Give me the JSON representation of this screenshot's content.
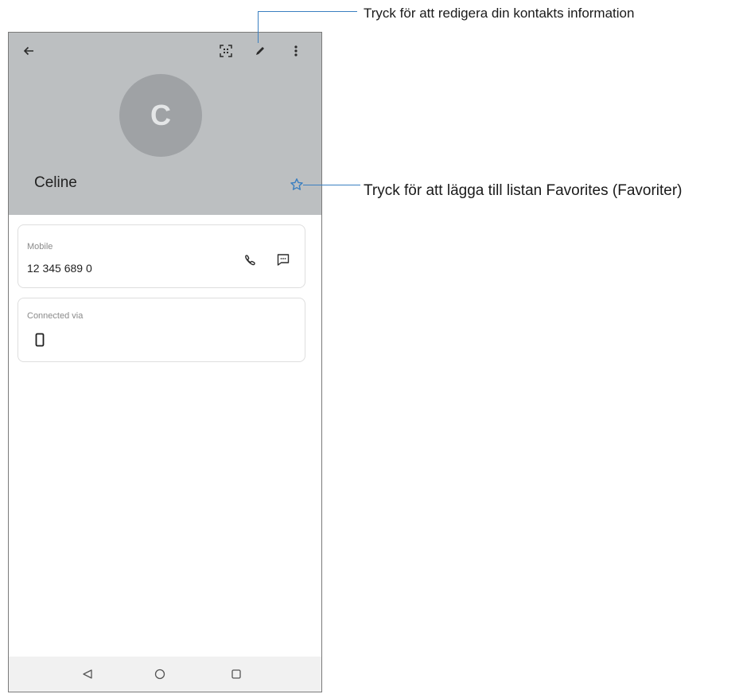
{
  "contact": {
    "initial": "C",
    "name": "Celine"
  },
  "phone_card": {
    "label": "Mobile",
    "number": "12 345 689 0"
  },
  "connected_card": {
    "label": "Connected via"
  },
  "callouts": {
    "edit": "Tryck för att redigera din kontakts information",
    "favorite": "Tryck för att lägga till listan Favorites (Favoriter)"
  },
  "colors": {
    "header_bg": "#bcbfc1",
    "avatar_bg": "#9fa2a5",
    "star": "#3a7fc1",
    "callout_line": "#3a7fc1"
  }
}
